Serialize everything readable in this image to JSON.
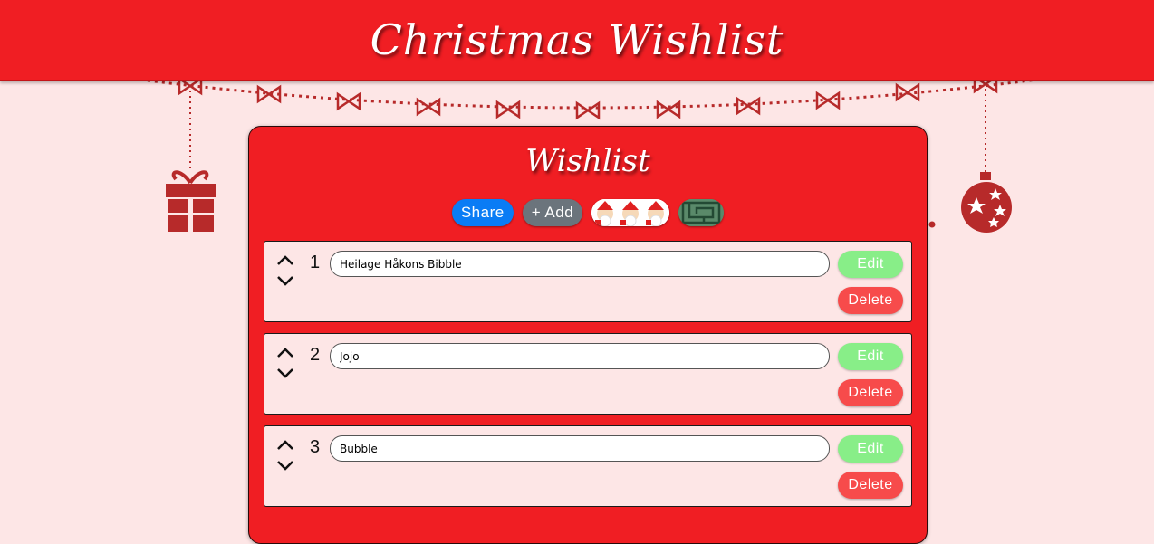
{
  "header": {
    "title": "Christmas Wishlist"
  },
  "card": {
    "title": "Wishlist"
  },
  "toolbar": {
    "share_label": "Share",
    "add_label": "+ Add",
    "theme1_icon": "santa-theme-icon",
    "theme2_icon": "maze-theme-icon"
  },
  "items": [
    {
      "number": "1",
      "value": "Heilage Håkons Bibble",
      "edit_label": "Edit",
      "delete_label": "Delete"
    },
    {
      "number": "2",
      "value": "Jojo",
      "edit_label": "Edit",
      "delete_label": "Delete"
    },
    {
      "number": "3",
      "value": "Bubble",
      "edit_label": "Edit",
      "delete_label": "Delete"
    }
  ],
  "colors": {
    "primary_red": "#f01e23",
    "background": "#fde6e6",
    "share_blue": "#0a7cf5",
    "add_gray": "#6b747c",
    "edit_green": "#88ee88",
    "delete_red": "#f74b4b",
    "ornament_red": "#b72a2a"
  }
}
